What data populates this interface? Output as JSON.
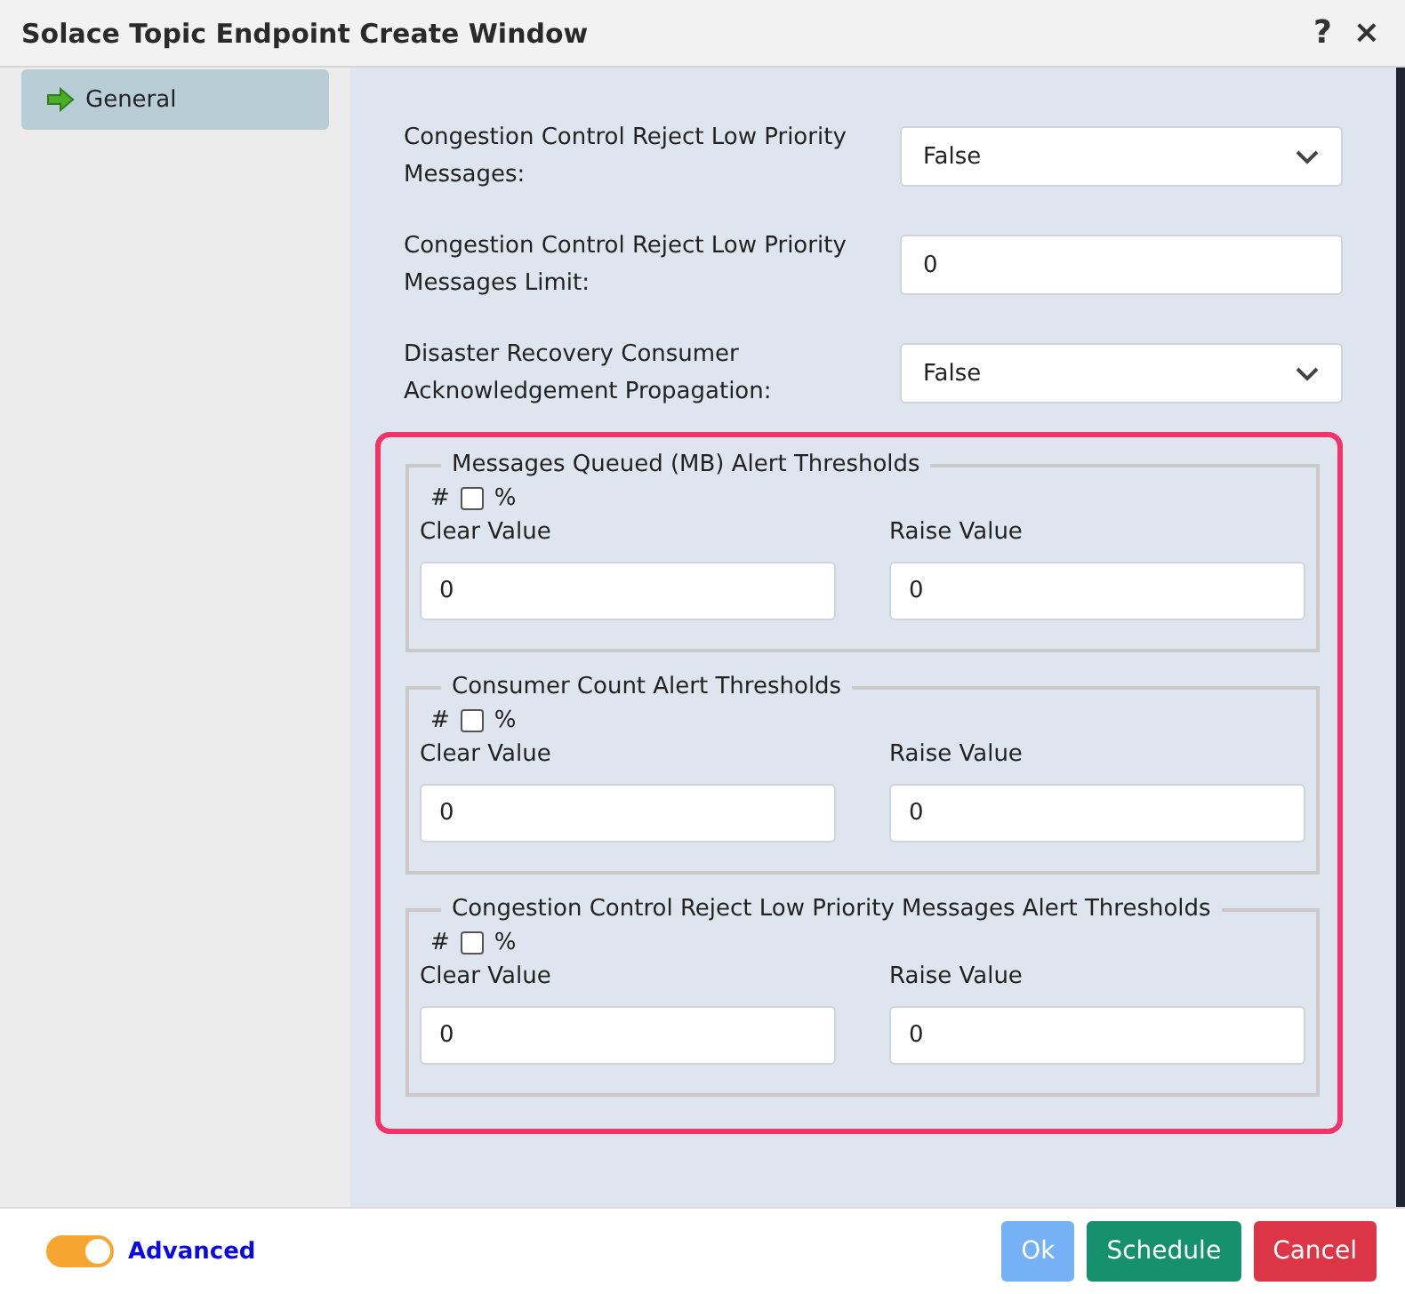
{
  "window": {
    "title": "Solace Topic Endpoint Create Window",
    "help": "?",
    "close": "×"
  },
  "sidebar": {
    "items": [
      {
        "label": "General",
        "selected": true
      }
    ]
  },
  "fields": [
    {
      "label": "Congestion Control Reject Low Priority Messages:",
      "kind": "select",
      "value": "False"
    },
    {
      "label": "Congestion Control Reject Low Priority Messages Limit:",
      "kind": "input",
      "value": "0"
    },
    {
      "label": "Disaster Recovery Consumer Acknowledgement Propagation:",
      "kind": "select",
      "value": "False"
    }
  ],
  "thresholds": [
    {
      "title": "Messages Queued (MB) Alert Thresholds",
      "hash": "#",
      "percent": "%",
      "checked": false,
      "clear_label": "Clear Value",
      "clear_value": "0",
      "raise_label": "Raise Value",
      "raise_value": "0"
    },
    {
      "title": "Consumer Count Alert Thresholds",
      "hash": "#",
      "percent": "%",
      "checked": false,
      "clear_label": "Clear Value",
      "clear_value": "0",
      "raise_label": "Raise Value",
      "raise_value": "0"
    },
    {
      "title": "Congestion Control Reject Low Priority Messages Alert Thresholds",
      "hash": "#",
      "percent": "%",
      "checked": false,
      "clear_label": "Clear Value",
      "clear_value": "0",
      "raise_label": "Raise Value",
      "raise_value": "0"
    }
  ],
  "footer": {
    "advanced": {
      "label": "Advanced",
      "on": true
    },
    "buttons": [
      {
        "label": "Ok",
        "kind": "primary",
        "disabled": true
      },
      {
        "label": "Schedule",
        "kind": "success",
        "disabled": false
      },
      {
        "label": "Cancel",
        "kind": "danger",
        "disabled": false
      }
    ]
  }
}
